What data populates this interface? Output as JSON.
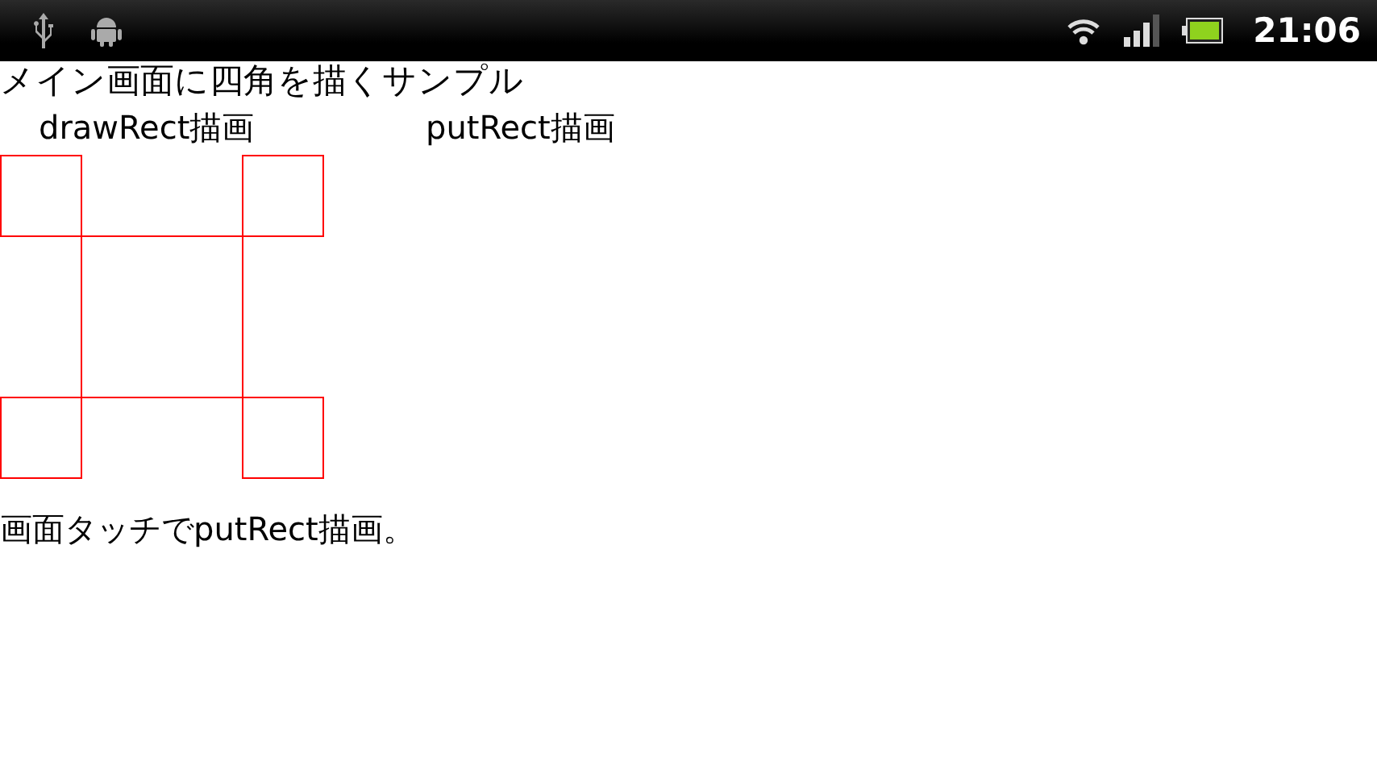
{
  "status_bar": {
    "time": "21:06"
  },
  "title": "メイン画面に四角を描くサンプル",
  "labels": [
    "drawRect描画",
    "putRect描画"
  ],
  "footer": "画面タッチでputRect描画。"
}
